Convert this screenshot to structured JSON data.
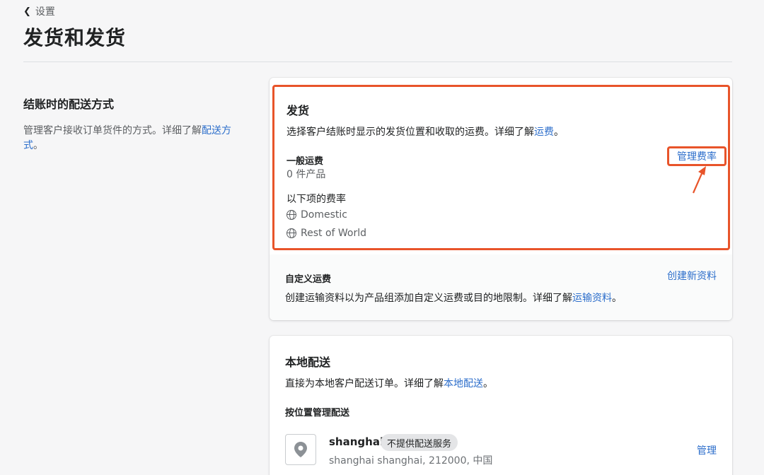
{
  "nav": {
    "back_label": "设置"
  },
  "page": {
    "title": "发货和发货"
  },
  "left_panel": {
    "heading": "结账时的配送方式",
    "desc_prefix": "管理客户接收订单货件的方式。详细了解",
    "desc_link": "配送方式",
    "desc_suffix": "。"
  },
  "shipping": {
    "heading": "发货",
    "desc_prefix": "选择客户结账时显示的发货位置和收取的运费。详细了解",
    "desc_link": "运费",
    "desc_suffix": "。",
    "general_label": "一般运费",
    "product_count": "0 件产品",
    "manage_rates": "管理费率",
    "rates_for": "以下项的费率",
    "zones": [
      "Domestic",
      "Rest of World"
    ]
  },
  "custom_rates": {
    "heading": "自定义运费",
    "action": "创建新资料",
    "desc_prefix": "创建运输资料以为产品组添加自定义运费或目的地限制。详细了解",
    "desc_link": "运输资料",
    "desc_suffix": "。"
  },
  "local_delivery": {
    "heading": "本地配送",
    "desc_prefix": "直接为本地客户配送订单。详细了解",
    "desc_link": "本地配送",
    "desc_suffix": "。",
    "section_label": "按位置管理配送",
    "location": {
      "name": "shanghai",
      "badge": "不提供配送服务",
      "address": "shanghai shanghai, 212000, 中国",
      "manage": "管理"
    }
  },
  "colors": {
    "link": "#2c6ecb",
    "highlight": "#e8542a"
  }
}
